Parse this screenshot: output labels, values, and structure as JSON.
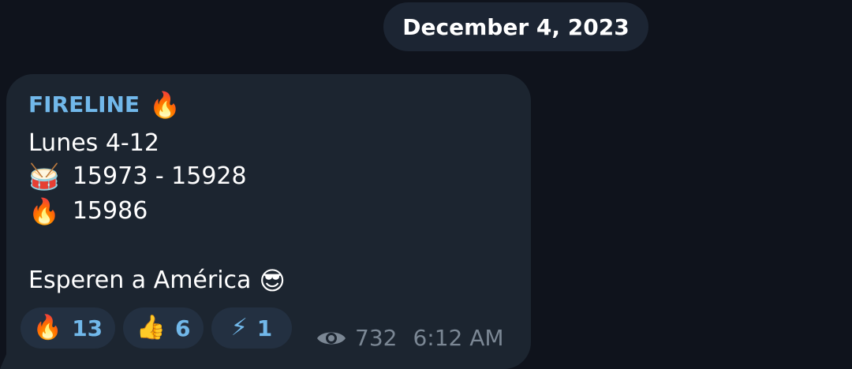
{
  "date_separator": "December 4, 2023",
  "message": {
    "sender": "FIRELINE",
    "sender_emoji": "🔥",
    "lines": [
      {
        "emoji": "",
        "text": "Lunes 4-12"
      },
      {
        "emoji": "🥁",
        "text": "15973 - 15928"
      },
      {
        "emoji": "🔥",
        "text": "15986"
      },
      {
        "emoji": "",
        "text": ""
      },
      {
        "emoji": "😎",
        "text": "Esperen a América"
      }
    ],
    "reactions": [
      {
        "emoji": "🔥",
        "count": "13"
      },
      {
        "emoji": "👍",
        "count": "6"
      },
      {
        "emoji": "⚡",
        "count": "1"
      }
    ],
    "views": "732",
    "time": "6:12 AM",
    "icons": {
      "views": "eye-icon"
    },
    "colors": {
      "sender": "#71b8ea",
      "bubble": "#1c2530",
      "background": "#0f131c",
      "reaction_bg": "#233041",
      "meta_text": "#7b8794"
    }
  }
}
